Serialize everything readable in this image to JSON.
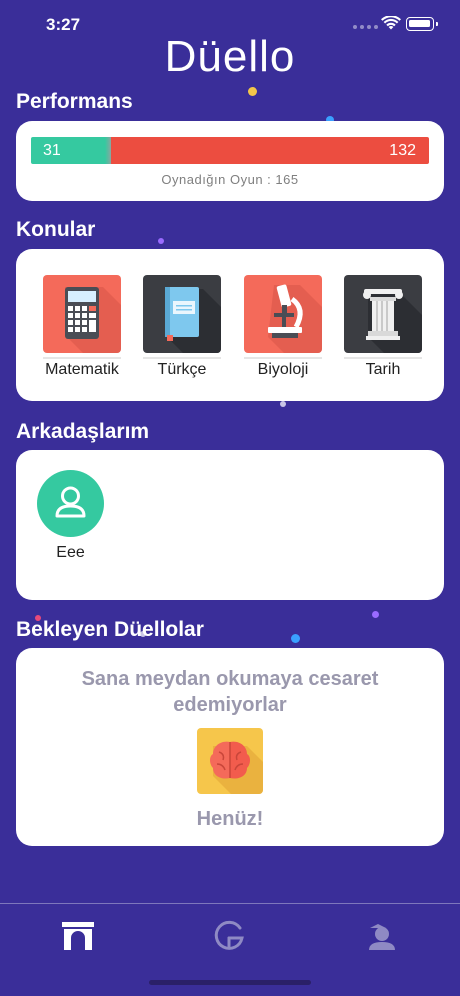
{
  "status_bar": {
    "time": "3:27"
  },
  "app": {
    "title": "Düello"
  },
  "performance": {
    "title": "Performans",
    "wins": "31",
    "losses": "132",
    "total_label": "Oynadığın Oyun : 165"
  },
  "topics": {
    "title": "Konular",
    "items": [
      {
        "label": "Matematik",
        "icon": "calculator-icon",
        "color": "#f46a5a"
      },
      {
        "label": "Türkçe",
        "icon": "book-icon",
        "color": "#3b3d42"
      },
      {
        "label": "Biyoloji",
        "icon": "microscope-icon",
        "color": "#f46a5a"
      },
      {
        "label": "Tarih",
        "icon": "column-icon",
        "color": "#3b3d42"
      }
    ]
  },
  "friends": {
    "title": "Arkadaşlarım",
    "items": [
      {
        "name": "Eee",
        "icon": "user-icon"
      }
    ]
  },
  "pending": {
    "title": "Bekleyen Düellolar",
    "message": "Sana meydan okumaya cesaret edemiyorlar",
    "subtitle": "Henüz!",
    "icon": "brain-icon"
  },
  "tab_bar": {
    "items": [
      {
        "icon": "home-arch-icon",
        "active": true
      },
      {
        "icon": "duel-g-icon",
        "active": false
      },
      {
        "icon": "profile-icon",
        "active": false
      }
    ]
  },
  "colors": {
    "background": "#3a2e99",
    "win": "#35c9a0",
    "loss": "#ec4d40",
    "card": "#ffffff"
  }
}
